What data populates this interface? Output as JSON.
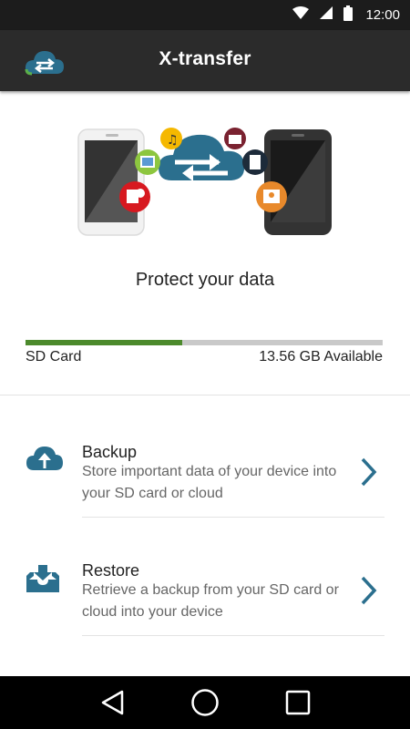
{
  "status_bar": {
    "time": "12:00"
  },
  "app_bar": {
    "title": "X-transfer",
    "logo": "cloud-transfer-logo"
  },
  "hero": {
    "tagline": "Protect your data"
  },
  "storage": {
    "name": "SD Card",
    "available": "13.56 GB Available",
    "used_fraction": 0.44
  },
  "actions": [
    {
      "title": "Backup",
      "description": "Store important data of your device into your SD card or cloud",
      "icon": "cloud-upload-icon"
    },
    {
      "title": "Restore",
      "description": "Retrieve a backup from your SD card or cloud into your device",
      "icon": "inbox-download-icon"
    }
  ],
  "colors": {
    "status_bar": "#1c1c1c",
    "app_bar": "#2b2b2b",
    "accent": "#2b6f8e",
    "storage_fill": "#4c8a2c",
    "storage_track": "#c9c9c9"
  },
  "nav": {
    "icons": [
      "back-icon",
      "home-icon",
      "recents-icon"
    ]
  }
}
